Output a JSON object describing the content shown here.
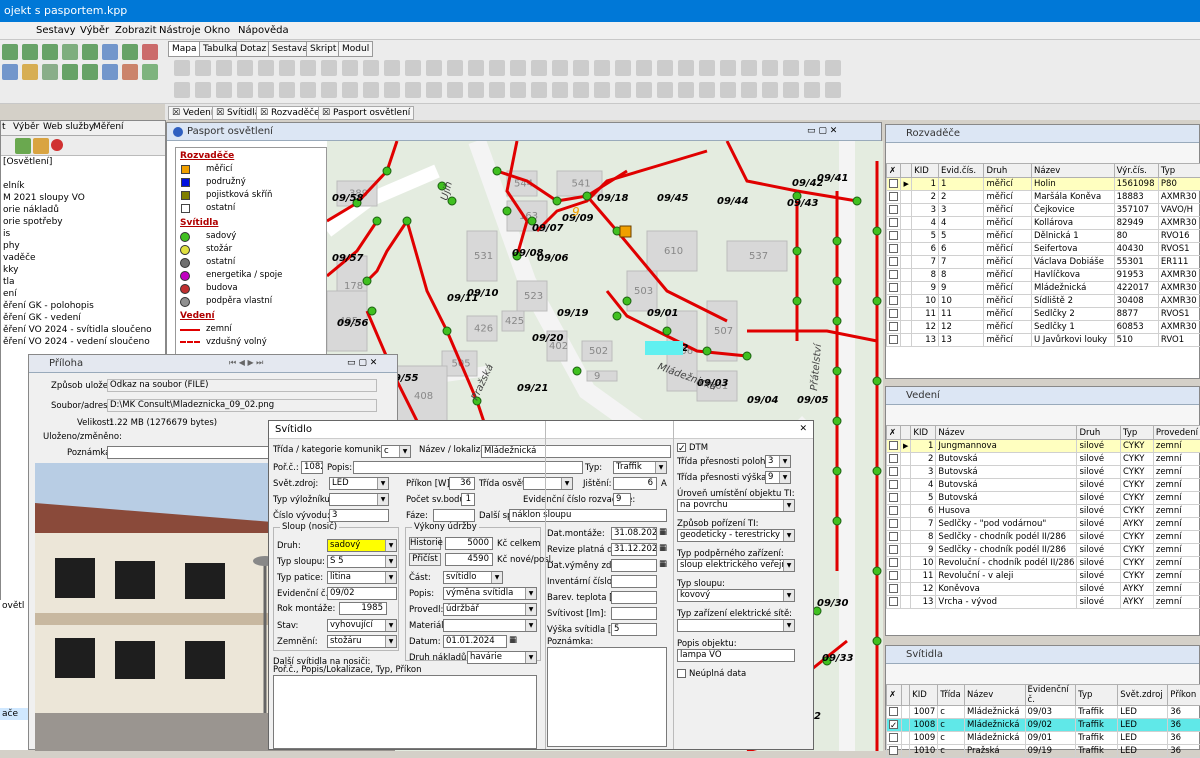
{
  "window": {
    "title": "ojekt s pasportem.kpp"
  },
  "menu": [
    "Sestavy",
    "Výběr",
    "Zobrazit",
    "Nástroje",
    "Okno",
    "Nápověda"
  ],
  "ribbon_tabs": [
    "Mapa",
    "Tabulka",
    "Dotaz",
    "Sestava",
    "Skript",
    "Modul"
  ],
  "doc_tabs": [
    "Vedení",
    "Svítidla",
    "Rozvaděče",
    "Pasport osvětlení"
  ],
  "left": {
    "tabs": [
      "t",
      "Výběr",
      "Web služby",
      "Měření"
    ],
    "items": [
      "[Osvětlení]",
      "",
      "elník",
      "M 2021 sloupy VO",
      "orie nákladů",
      "orie spotřeby",
      "is",
      "phy",
      "vaděče",
      "kky",
      "tla",
      "ení",
      "ěření GK - polohopis",
      "ěření GK - vedení",
      "ěření VO 2024 - svítidla sloučeno",
      "ěření VO 2024 - vedení sloučeno"
    ],
    "items2": [
      "nled pro",
      "nled pro",
      "ledání",
      "parizace",
      "nkování",
      "erovat"
    ],
    "items3": [
      "ovětl",
      "",
      "",
      "",
      "",
      "",
      "",
      "",
      "",
      "ače"
    ]
  },
  "map_window": {
    "title": "Pasport osvětlení",
    "legend": {
      "rozvadece_title": "Rozvaděče",
      "rozvadece": [
        {
          "label": "měřicí",
          "color": "#f0a000"
        },
        {
          "label": "podružný",
          "color": "#0010e0"
        },
        {
          "label": "pojistková skříň",
          "color": "#808000"
        },
        {
          "label": "ostatní",
          "color": "#ffffff"
        }
      ],
      "svitidla_title": "Svítidla",
      "svitidla": [
        {
          "label": "sadový",
          "color": "#40c020"
        },
        {
          "label": "stožár",
          "color": "#e0e040"
        },
        {
          "label": "ostatní",
          "color": "#707070"
        },
        {
          "label": "energetika / spoje",
          "color": "#c000c0"
        },
        {
          "label": "budova",
          "color": "#c03030"
        },
        {
          "label": "podpěra vlastní",
          "color": "#909090"
        }
      ],
      "vedeni_title": "Vedení",
      "vedeni": [
        {
          "label": "zemní"
        },
        {
          "label": "vzdušný volný"
        }
      ]
    },
    "labels": [
      "09/58",
      "09/57",
      "09/56",
      "09/55",
      "09/11",
      "09/10",
      "09/08",
      "09/07",
      "09/09",
      "09/18",
      "09/06",
      "09/19",
      "09/20",
      "09/21",
      "09/22",
      "09/01",
      "09/02",
      "09/03",
      "09/04",
      "09/05",
      "09/45",
      "09/44",
      "09/43",
      "09/42",
      "09/41",
      "09/30",
      "09/33",
      "32"
    ],
    "buildings": [
      "389",
      "178",
      "163",
      "531",
      "523",
      "426",
      "425",
      "402",
      "505",
      "502",
      "408",
      "501",
      "506",
      "507",
      "503",
      "544",
      "541",
      "537",
      "610",
      "495",
      "9"
    ],
    "streets": [
      "Pražská",
      "Mládežnická",
      "Přátelství",
      "Ujih"
    ]
  },
  "rozvadece": {
    "title": "Rozvaděče",
    "columns": [
      "KID",
      "Evid.čís.",
      "Druh",
      "Název",
      "Výr.čís.",
      "Typ"
    ],
    "rows": [
      [
        "1",
        "1",
        "měřicí",
        "Holin",
        "1561098",
        "P80"
      ],
      [
        "2",
        "2",
        "měřicí",
        "Maršála Koněva",
        "18883",
        "AXMR30"
      ],
      [
        "3",
        "3",
        "měřicí",
        "Čejkovice",
        "357107",
        "VAVO/H"
      ],
      [
        "4",
        "4",
        "měřicí",
        "Kollárova",
        "82949",
        "AXMR30"
      ],
      [
        "5",
        "5",
        "měřicí",
        "Dělnická 1",
        "80",
        "RVO16"
      ],
      [
        "6",
        "6",
        "měřicí",
        "Seifertova",
        "40430",
        "RVOS1"
      ],
      [
        "7",
        "7",
        "měřicí",
        "Václava Dobiáše",
        "55301",
        "ER111"
      ],
      [
        "8",
        "8",
        "měřicí",
        "Havlíčkova",
        "91953",
        "AXMR30"
      ],
      [
        "9",
        "9",
        "měřicí",
        "Mládežnická",
        "422017",
        "AXMR30"
      ],
      [
        "10",
        "10",
        "měřicí",
        "Sídliště 2",
        "30408",
        "AXMR30"
      ],
      [
        "11",
        "11",
        "měřicí",
        "Sedlčky 2",
        "8877",
        "RVOS1"
      ],
      [
        "12",
        "12",
        "měřicí",
        "Sedlčky 1",
        "60853",
        "AXMR30"
      ],
      [
        "13",
        "13",
        "měřicí",
        "U Javůrkovi louky",
        "510",
        "RVO1"
      ]
    ]
  },
  "vedeni": {
    "title": "Vedení",
    "columns": [
      "KID",
      "Název",
      "Druh",
      "Typ",
      "Provedení"
    ],
    "rows": [
      [
        "1",
        "Jungmannova",
        "silové",
        "CYKY",
        "zemní"
      ],
      [
        "2",
        "Butovská",
        "silové",
        "CYKY",
        "zemní"
      ],
      [
        "3",
        "Butovská",
        "silové",
        "CYKY",
        "zemní"
      ],
      [
        "4",
        "Butovská",
        "silové",
        "CYKY",
        "zemní"
      ],
      [
        "5",
        "Butovská",
        "silové",
        "CYKY",
        "zemní"
      ],
      [
        "6",
        "Husova",
        "silové",
        "CYKY",
        "zemní"
      ],
      [
        "7",
        "Sedlčky - \"pod vodárnou\"",
        "silové",
        "AYKY",
        "zemní"
      ],
      [
        "8",
        "Sedlčky - chodník podél II/286",
        "silové",
        "CYKY",
        "zemní"
      ],
      [
        "9",
        "Sedlčky - chodník podél II/286",
        "silové",
        "CYKY",
        "zemní"
      ],
      [
        "10",
        "Revoluční - chodník podél II/286",
        "silové",
        "CYKY",
        "zemní"
      ],
      [
        "11",
        "Revoluční - v aleji",
        "silové",
        "CYKY",
        "zemní"
      ],
      [
        "12",
        "Koněvova",
        "silové",
        "AYKY",
        "zemní"
      ],
      [
        "13",
        "Vrcha - vývod",
        "silové",
        "AYKY",
        "zemní"
      ]
    ]
  },
  "svitidla": {
    "title": "Svítidla",
    "columns": [
      "KID",
      "Třída",
      "Název",
      "Evidenční č.",
      "Typ",
      "Svět.zdroj",
      "Příkon"
    ],
    "rows": [
      [
        "1007",
        "c",
        "Mládežnická",
        "09/03",
        "Traffik",
        "LED",
        "36"
      ],
      [
        "1008",
        "c",
        "Mládežnická",
        "09/02",
        "Traffik",
        "LED",
        "36"
      ],
      [
        "1009",
        "c",
        "Mládežnická",
        "09/01",
        "Traffik",
        "LED",
        "36"
      ],
      [
        "1010",
        "c",
        "Pražská",
        "09/19",
        "Traffik",
        "LED",
        "36"
      ]
    ]
  },
  "priloha": {
    "title": "Příloha",
    "zpusob_label": "Způsob uložení:",
    "zpusob": "Odkaz na soubor (FILE)",
    "soubor_label": "Soubor/adresa:",
    "soubor": "D:\\MK Consult\\Mladeznicka_09_02.png",
    "velikost_label": "Velikost:",
    "velikost": "1.22 MB (1276679 bytes)",
    "ulozeno_label": "Uloženo/změněno:",
    "poznamka_label": "Poznámka:"
  },
  "svitidlo": {
    "title": "Svítidlo",
    "trida_label": "Třída / kategorie komunikace:",
    "trida": "c",
    "nazev_label": "Název / lokalizace:",
    "nazev": "Mládežnická",
    "typ_label": "Typ:",
    "typ": "Traffik",
    "porc_label": "Poř.č.:",
    "porc": "1082",
    "popis_label": "Popis:",
    "svet_label": "Svět.zdroj:",
    "svet": "LED",
    "prikon_label": "Příkon [W]:",
    "prikon": "36",
    "trida_osvet_label": "Třída osvět.:",
    "jisteni_label": "Jištění:",
    "jisteni": "6",
    "jisteni_unit": "A",
    "vyloznik_label": "Typ výložníku:",
    "pocet_label": "Počet sv.bodů:",
    "pocet": "1",
    "evid_rozv_label": "Evidenční číslo rozvaděče:",
    "evid_rozv": "9",
    "cislo_label": "Číslo vývodu:",
    "cislo": "3",
    "faze_label": "Fáze:",
    "dalsi_label": "Další specif.:",
    "dalsi": "náklon sloupu",
    "sloup_title": "Sloup (nosič)",
    "druh_label": "Druh:",
    "druh": "sadový",
    "typ_sloupu_label": "Typ sloupu:",
    "typ_sloupu": "S 5",
    "patice_label": "Typ patice:",
    "patice": "litina",
    "evidc_label": "Evidenční č.:",
    "evidc": "09/02",
    "rok_label": "Rok montáže:",
    "rok": "1985",
    "stav_label": "Stav:",
    "stav": "vyhovující",
    "zemneni_label": "Zemnění:",
    "zemneni": "stožáru",
    "udrzba_title": "Výkony údržby",
    "historie": "Historie",
    "historie_val": "5000",
    "celkem": "Kč celkem",
    "pridat": "Přičíst",
    "pridat_val": "4590",
    "nove": "Kč nové/posl.",
    "cast_label": "Část:",
    "cast": "svítidlo",
    "popis2_label": "Popis:",
    "popis2": "výměna svítidla",
    "provedl_label": "Provedl:",
    "provedl": "údržbář",
    "material_label": "Materiál:",
    "datum_label": "Datum:",
    "datum": "01.01.2024",
    "druh_nakl_label": "Druh nákladů:",
    "druh_nakl": "havárie",
    "dat_mont_label": "Dat.montáže:",
    "dat_mont": "31.08.2022",
    "revize_label": "Revize platná do:",
    "revize": "31.12.2026",
    "vymeny_label": "Dat.výměny zdroje",
    "invent_label": "Inventární číslo:",
    "barev_label": "Barev. teplota [K]:",
    "svitivost_label": "Svítivost [lm]:",
    "vyska_label": "Výška svítidla [m]:",
    "vyska": "5",
    "poznamka_label": "Poznámka:",
    "dalsi_svit": "Další svítidla na nosiči:",
    "dalsi_svit2": "Poř.č., Popis/Lokalizace, Typ, Příkon",
    "dtm_label": "DTM",
    "presnost_poloha_label": "Třída přesnosti poloha:",
    "presnost_poloha": "3",
    "presnost_vyska_label": "Třída přesnosti výška:",
    "presnost_vyska": "9",
    "uroven_label": "Úroveň umístění objektu TI:",
    "uroven": "na povrchu",
    "zpusob_label": "Způsob pořízení TI:",
    "zpusob": "geodeticky - terestricky",
    "podperne_label": "Typ podpěrného zařízení:",
    "podperne": "sloup elektrického veřejného os",
    "typ_sloupu2_label": "Typ sloupu:",
    "typ_sloupu2": "kovový",
    "typ_zar_label": "Typ zařízení elektrické sítě:",
    "popis_obj_label": "Popis objektu:",
    "popis_obj": "lampa VO",
    "neuplna_label": "Neúplná data"
  }
}
